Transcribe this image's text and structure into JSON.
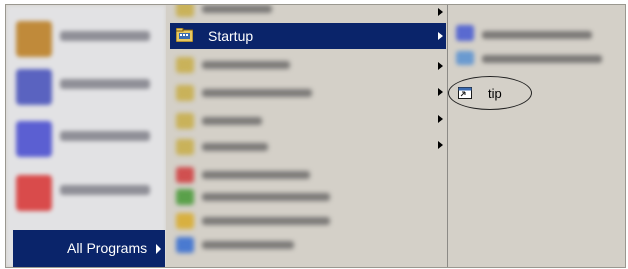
{
  "start_menu": {
    "all_programs_label": "All Programs"
  },
  "programs_menu": {
    "startup_label": "Startup"
  },
  "startup_menu": {
    "items": [
      {
        "label": "tip",
        "icon": "shortcut-icon"
      }
    ]
  },
  "colors": {
    "highlight": "#0a246a",
    "menu_bg": "#d4d0c8",
    "highlight_text": "#ffffff"
  }
}
